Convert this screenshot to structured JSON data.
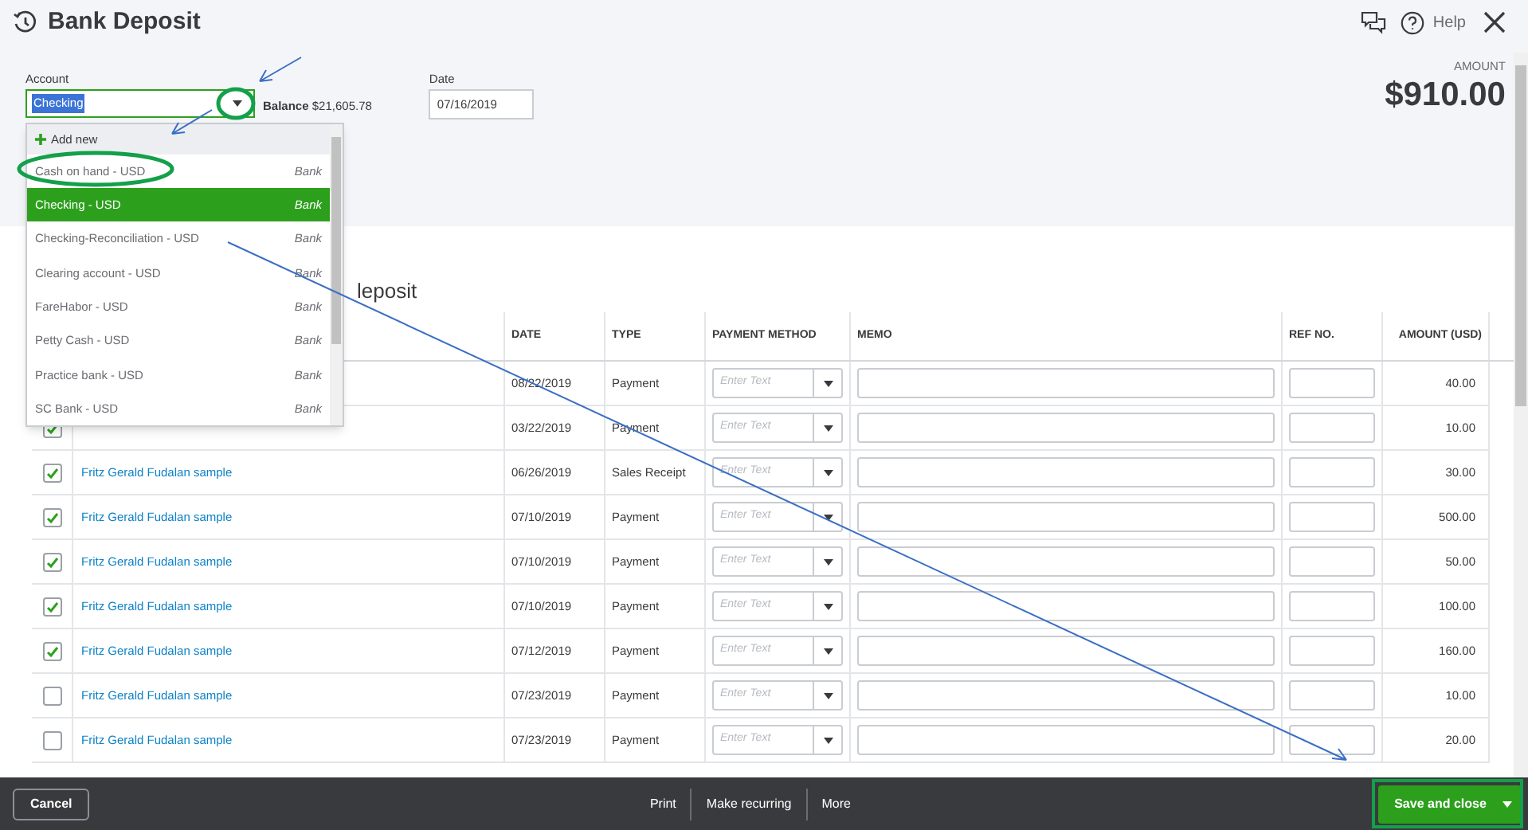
{
  "window": {
    "title": "Bank Deposit",
    "help": "Help"
  },
  "account": {
    "label": "Account",
    "value": "Checking",
    "balance_label": "Balance",
    "balance": "$21,605.78"
  },
  "date": {
    "label": "Date",
    "value": "07/16/2019"
  },
  "amount": {
    "label": "AMOUNT",
    "value": "$910.00"
  },
  "account_dropdown": {
    "add_new": "Add new",
    "items": [
      {
        "name": "Cash on hand - USD",
        "type": "Bank",
        "selected": false
      },
      {
        "name": "Checking - USD",
        "type": "Bank",
        "selected": true
      },
      {
        "name": "Checking-Reconciliation - USD",
        "type": "Bank",
        "selected": false
      },
      {
        "name": "Clearing account - USD",
        "type": "Bank",
        "selected": false
      },
      {
        "name": "FareHabor - USD",
        "type": "Bank",
        "selected": false
      },
      {
        "name": "Petty Cash - USD",
        "type": "Bank",
        "selected": false
      },
      {
        "name": "Practice bank - USD",
        "type": "Bank",
        "selected": false
      },
      {
        "name": "SC Bank - USD",
        "type": "Bank",
        "selected": false
      }
    ]
  },
  "section_title": "leposit",
  "table": {
    "columns": [
      "DATE",
      "TYPE",
      "PAYMENT METHOD",
      "MEMO",
      "REF NO.",
      "AMOUNT (USD)"
    ],
    "rows": [
      {
        "date": "08/22/2019",
        "type": "Payment",
        "payment_method": {
          "placeholder": "Enter Text"
        },
        "amount": "40.00"
      },
      {
        "checked": true,
        "date": "03/22/2019",
        "type": "Payment",
        "payment_method": {
          "placeholder": "Enter Text"
        },
        "amount": "10.00"
      },
      {
        "checked": true,
        "name": "Fritz Gerald Fudalan sample",
        "date": "06/26/2019",
        "type": "Sales Receipt",
        "payment_method": {
          "placeholder": "Enter Text"
        },
        "amount": "30.00"
      },
      {
        "checked": true,
        "name": "Fritz Gerald Fudalan sample",
        "date": "07/10/2019",
        "type": "Payment",
        "payment_method": {
          "placeholder": "Enter Text"
        },
        "amount": "500.00"
      },
      {
        "checked": true,
        "name": "Fritz Gerald Fudalan sample",
        "date": "07/10/2019",
        "type": "Payment",
        "payment_method": {
          "placeholder": "Enter Text"
        },
        "amount": "50.00"
      },
      {
        "checked": true,
        "name": "Fritz Gerald Fudalan sample",
        "date": "07/10/2019",
        "type": "Payment",
        "payment_method": {
          "placeholder": "Enter Text"
        },
        "amount": "100.00"
      },
      {
        "checked": true,
        "name": "Fritz Gerald Fudalan sample",
        "date": "07/12/2019",
        "type": "Payment",
        "payment_method": {
          "placeholder": "Enter Text"
        },
        "amount": "160.00"
      },
      {
        "checked": false,
        "name": "Fritz Gerald Fudalan sample",
        "date": "07/23/2019",
        "type": "Payment",
        "payment_method": {
          "placeholder": "Enter Text"
        },
        "amount": "10.00"
      },
      {
        "checked": false,
        "name": "Fritz Gerald Fudalan sample",
        "date": "07/23/2019",
        "type": "Payment",
        "payment_method": {
          "placeholder": "Enter Text"
        },
        "amount": "20.00"
      }
    ]
  },
  "footer": {
    "cancel": "Cancel",
    "actions": [
      "Print",
      "Make recurring",
      "More"
    ],
    "save": "Save and close"
  }
}
